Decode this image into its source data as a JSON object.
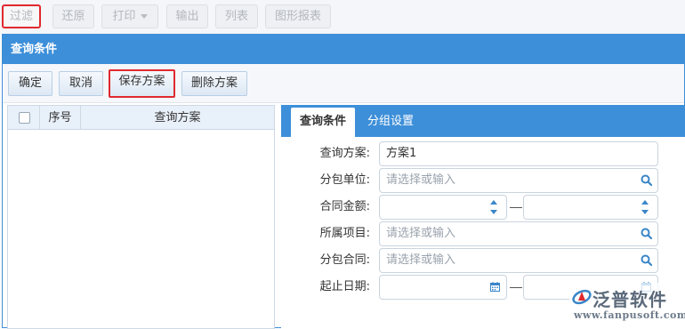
{
  "toolbar": {
    "filter": "过滤",
    "restore": "还原",
    "print": "打印",
    "export": "输出",
    "list": "列表",
    "chart_report": "图形报表"
  },
  "dialog": {
    "title": "查询条件",
    "actions": {
      "confirm": "确定",
      "cancel": "取消",
      "save_scheme": "保存方案",
      "delete_scheme": "删除方案"
    },
    "scheme_list": {
      "columns": [
        "序号",
        "查询方案"
      ],
      "rows": []
    },
    "tabs": [
      "查询条件",
      "分组设置"
    ],
    "active_tab": "查询条件",
    "form": {
      "scheme_label": "查询方案:",
      "scheme_value": "方案1",
      "subcontractor_label": "分包单位:",
      "subcontractor_placeholder": "请选择或输入",
      "amount_label": "合同金额:",
      "project_label": "所属项目:",
      "project_placeholder": "请选择或输入",
      "subcontract_label": "分包合同:",
      "subcontract_placeholder": "请选择或输入",
      "date_label": "起止日期:",
      "range_separator": "—"
    }
  },
  "watermark": {
    "brand": "泛普软件",
    "url": "www.fanpusoft.com"
  },
  "colors": {
    "header_blue": "#3d8fd9",
    "highlight_red": "#e0292e"
  }
}
